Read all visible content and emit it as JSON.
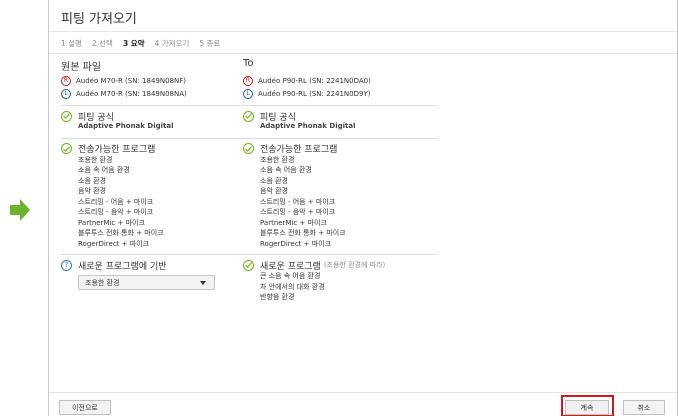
{
  "dialog": {
    "title": "피팅 가져오기",
    "steps": [
      {
        "label": "1 설명",
        "active": false
      },
      {
        "label": "2 선택",
        "active": false
      },
      {
        "label": "3 요약",
        "active": true
      },
      {
        "label": "4 가져오기",
        "active": false
      },
      {
        "label": "5 종료",
        "active": false
      }
    ]
  },
  "left": {
    "heading": "원본 파일",
    "devices": [
      {
        "side": "R",
        "text": "Audéo M70-R (SN: 1849N08NF)"
      },
      {
        "side": "L",
        "text": "Audéo M70-R (SN: 1849N08NA)"
      }
    ],
    "fitting_formula": {
      "title": "피팅 공식",
      "value": "Adaptive Phonak Digital"
    },
    "programs": {
      "title": "전송가능한 프로그램",
      "items": [
        "조용한 환경",
        "소음 속 어음 환경",
        "소음 환경",
        "음악 환경",
        "스트리밍 - 어음 + 마이크",
        "스트리밍 - 음악 + 마이크",
        "PartnerMic + 마이크",
        "블루투스 전화 통화 + 마이크",
        "RogerDirect + 마이크"
      ]
    },
    "new_program": {
      "title": "새로운 프로그램에 기반",
      "selected": "조용한 환경"
    }
  },
  "right": {
    "heading": "To",
    "devices": [
      {
        "side": "R",
        "text": "Audéo P90-RL (SN: 2241N0DA0)"
      },
      {
        "side": "L",
        "text": "Audéo P90-RL (SN: 2241N0D9Y)"
      }
    ],
    "fitting_formula": {
      "title": "피팅 공식",
      "value": "Adaptive Phonak Digital"
    },
    "programs": {
      "title": "전송가능한 프로그램",
      "items": [
        "조용한 환경",
        "소음 속 어음 환경",
        "소음 환경",
        "음악 환경",
        "스트리밍 - 어음 + 마이크",
        "스트리밍 - 음악 + 마이크",
        "PartnerMic + 마이크",
        "블루투스 전화 통화 + 마이크",
        "RogerDirect + 마이크"
      ]
    },
    "new_programs": {
      "title": "새로운 프로그램",
      "subtitle": "(조용한 환경에 따라)",
      "items": [
        "큰 소음 속 어음 환경",
        "차 안에서의 대화 환경",
        "반향음 환경"
      ]
    }
  },
  "footer": {
    "back_label": "이전으로",
    "next_label": "계속",
    "cancel_label": "취소"
  },
  "colors": {
    "arrow": "#6cb22a",
    "check": "#74b21f",
    "right_badge": "#c01818",
    "left_badge": "#1c57b8",
    "highlight": "#d01a1a"
  },
  "icons": {
    "arrow": "arrow-right-icon",
    "check": "check-circle-icon",
    "help": "question-circle-icon",
    "caret": "chevron-down-icon"
  }
}
